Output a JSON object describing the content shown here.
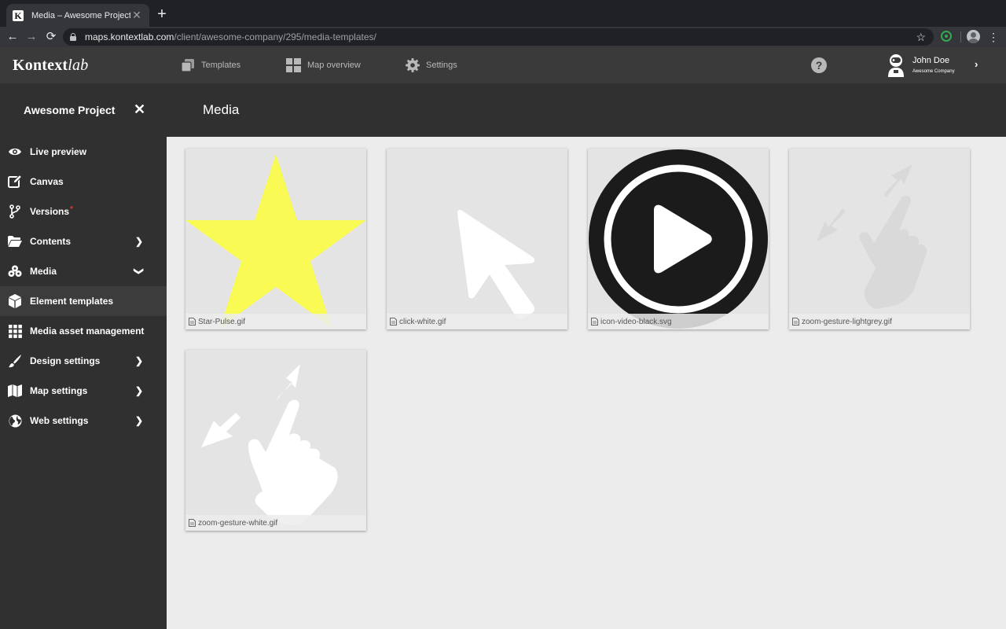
{
  "browser": {
    "tab_title": "Media – Awesome Project",
    "tab_favicon": "K",
    "url_host": "maps.kontextlab.com",
    "url_path": "/client/awesome-company/295/media-templates/"
  },
  "header": {
    "logo_main": "Kontext",
    "logo_lab": "lab",
    "nav": [
      {
        "label": "Templates",
        "icon": "templates-icon"
      },
      {
        "label": "Map overview",
        "icon": "grid-icon"
      },
      {
        "label": "Settings",
        "icon": "gear-icon"
      }
    ],
    "help": "?",
    "user": {
      "name": "John Doe",
      "company": "Awesome Company"
    }
  },
  "project": {
    "title": "Awesome Project",
    "page_title": "Media"
  },
  "sidebar": {
    "items": [
      {
        "label": "Live preview",
        "icon": "eye-icon"
      },
      {
        "label": "Canvas",
        "icon": "edit-icon"
      },
      {
        "label": "Versions",
        "icon": "branch-icon",
        "badge": "*"
      },
      {
        "label": "Contents",
        "icon": "folder-icon"
      },
      {
        "label": "Media",
        "icon": "media-icon"
      },
      {
        "label": "Element templates",
        "icon": "cube-icon"
      },
      {
        "label": "Media asset management",
        "icon": "grid-icon"
      },
      {
        "label": "Design settings",
        "icon": "brush-icon"
      },
      {
        "label": "Map settings",
        "icon": "map-icon"
      },
      {
        "label": "Web settings",
        "icon": "globe-icon"
      }
    ]
  },
  "media": {
    "items": [
      {
        "filename": "Star-Pulse.gif",
        "preview": "star-icon"
      },
      {
        "filename": "click-white.gif",
        "preview": "cursor-icon"
      },
      {
        "filename": "icon-video-black.svg",
        "preview": "play-icon"
      },
      {
        "filename": "zoom-gesture-lightgrey.gif",
        "preview": "zoom-gesture-icon"
      },
      {
        "filename": "zoom-gesture-white.gif",
        "preview": "zoom-gesture-icon"
      }
    ]
  },
  "colors": {
    "header_bg": "#3a3a3a",
    "sidebar_bg": "#303030",
    "content_bg": "#ececec",
    "star": "#fafa55",
    "badge": "#e53935"
  }
}
